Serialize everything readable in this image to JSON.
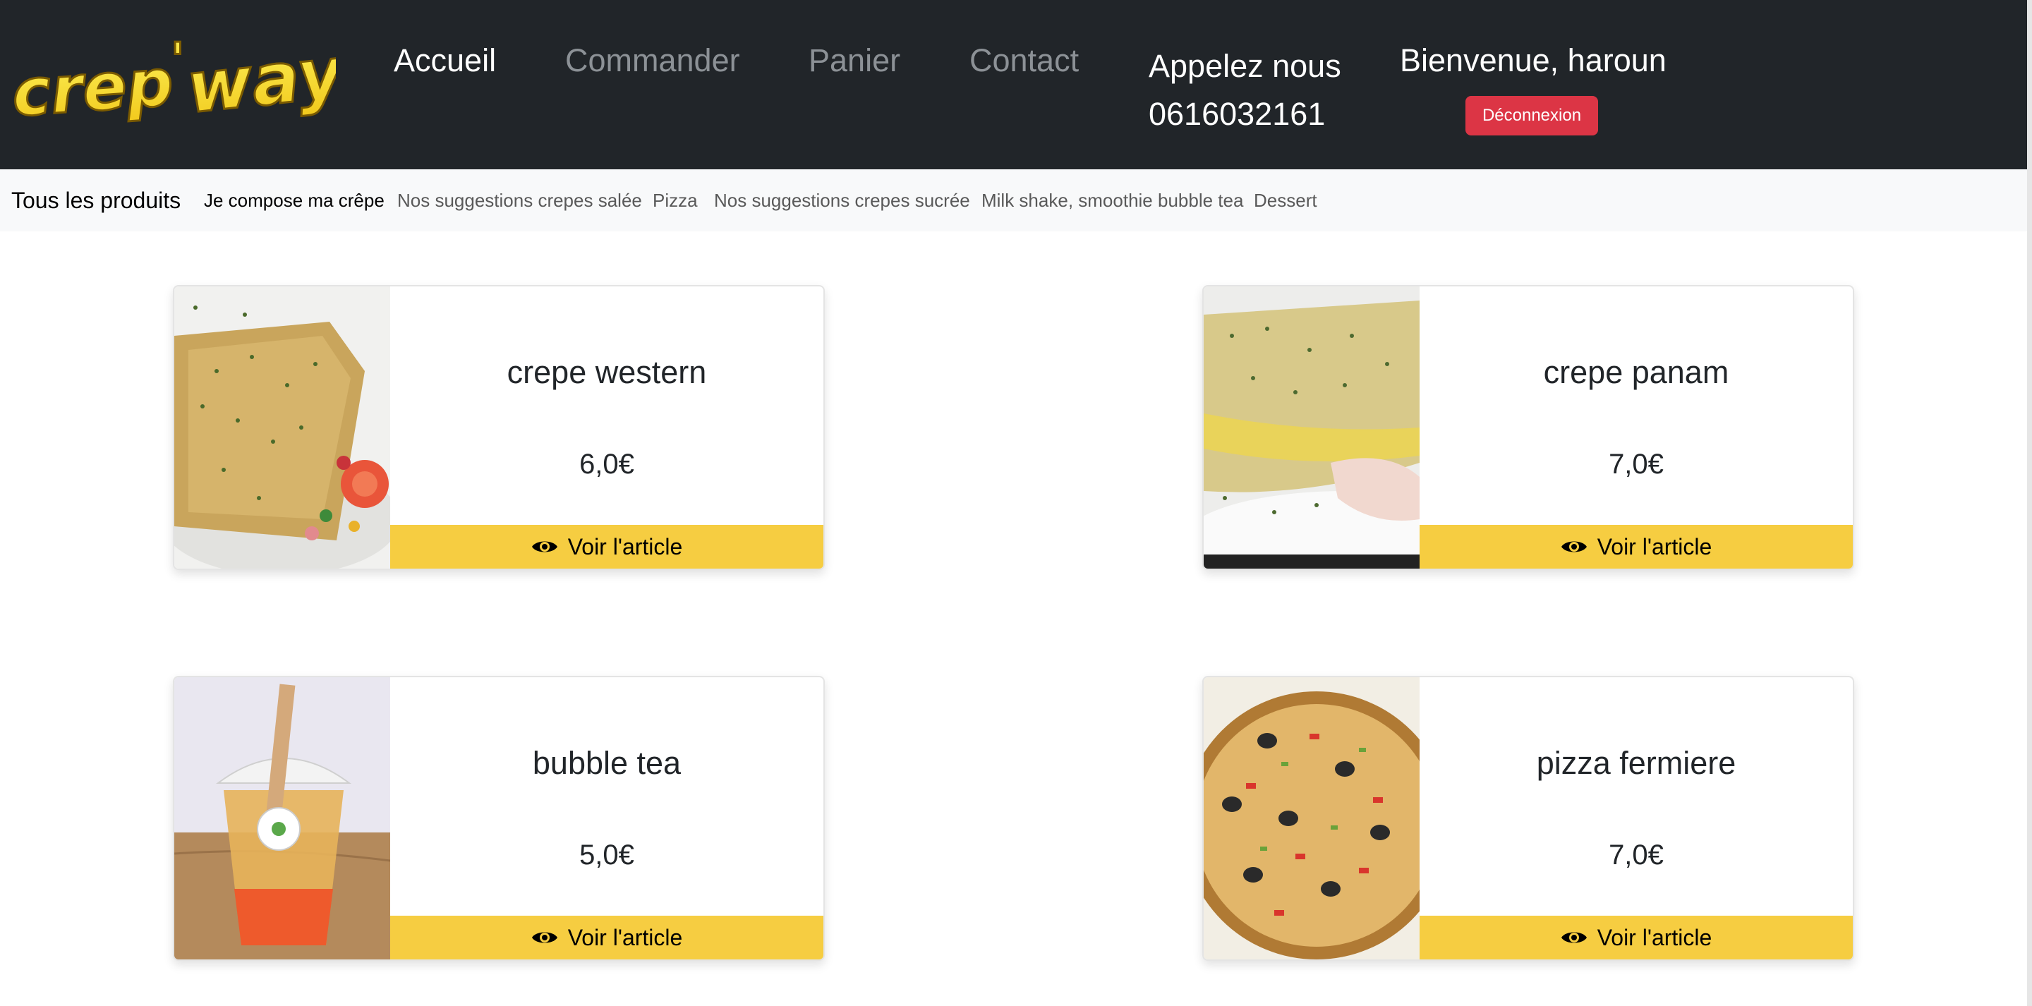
{
  "brand": {
    "logo_text": "crep'way",
    "accent": "#f6cd41",
    "logo_color": "#f7e23a"
  },
  "nav": {
    "items": [
      {
        "label": "Accueil",
        "active": true
      },
      {
        "label": "Commander",
        "active": false
      },
      {
        "label": "Panier",
        "active": false
      },
      {
        "label": "Contact",
        "active": false
      }
    ],
    "phone_label": "Appelez nous",
    "phone_number": "0616032161",
    "welcome": "Bienvenue, haroun",
    "logout_label": "Déconnexion",
    "logout_color": "#dc3545"
  },
  "categories": {
    "title": "Tous les produits",
    "items": [
      {
        "label": "Je compose ma crêpe",
        "active": true
      },
      {
        "label": "Nos suggestions crepes salée",
        "active": false
      },
      {
        "label": "Pizza",
        "active": false
      },
      {
        "label": "Nos suggestions crepes sucrée",
        "active": false
      },
      {
        "label": "Milk shake, smoothie bubble tea",
        "active": false
      },
      {
        "label": "Dessert",
        "active": false
      }
    ]
  },
  "products": [
    {
      "name": "crepe western",
      "price": "6,0€",
      "button": "Voir l'article",
      "image": "crepe-western-photo"
    },
    {
      "name": "crepe panam",
      "price": "7,0€",
      "button": "Voir l'article",
      "image": "crepe-panam-photo"
    },
    {
      "name": "bubble tea",
      "price": "5,0€",
      "button": "Voir l'article",
      "image": "bubble-tea-photo"
    },
    {
      "name": "pizza fermiere",
      "price": "7,0€",
      "button": "Voir l'article",
      "image": "pizza-fermiere-photo"
    }
  ]
}
